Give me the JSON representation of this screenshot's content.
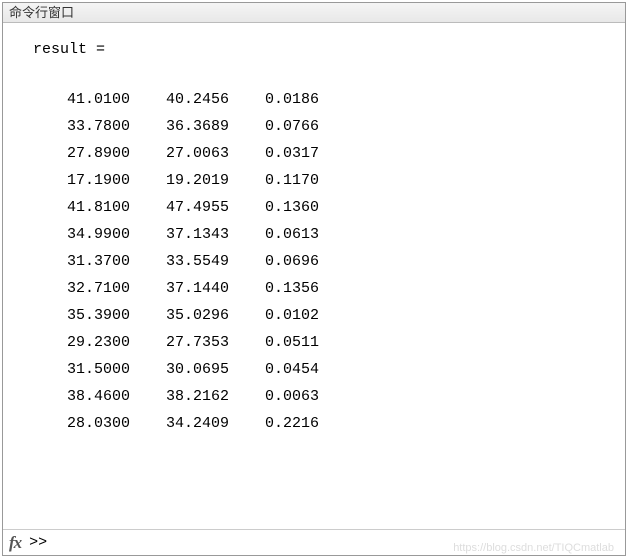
{
  "window": {
    "title": "命令行窗口"
  },
  "output": {
    "variable_label": "result ="
  },
  "chart_data": {
    "type": "table",
    "columns": 3,
    "rows": [
      [
        41.01,
        40.2456,
        0.0186
      ],
      [
        33.78,
        36.3689,
        0.0766
      ],
      [
        27.89,
        27.0063,
        0.0317
      ],
      [
        17.19,
        19.2019,
        0.117
      ],
      [
        41.81,
        47.4955,
        0.136
      ],
      [
        34.99,
        37.1343,
        0.0613
      ],
      [
        31.37,
        33.5549,
        0.0696
      ],
      [
        32.71,
        37.144,
        0.1356
      ],
      [
        35.39,
        35.0296,
        0.0102
      ],
      [
        29.23,
        27.7353,
        0.0511
      ],
      [
        31.5,
        30.0695,
        0.0454
      ],
      [
        38.46,
        38.2162,
        0.0063
      ],
      [
        28.03,
        34.2409,
        0.2216
      ]
    ]
  },
  "prompt": {
    "fx_label": "fx",
    "symbol": ">>"
  },
  "watermark": "https://blog.csdn.net/TIQCmatlab"
}
